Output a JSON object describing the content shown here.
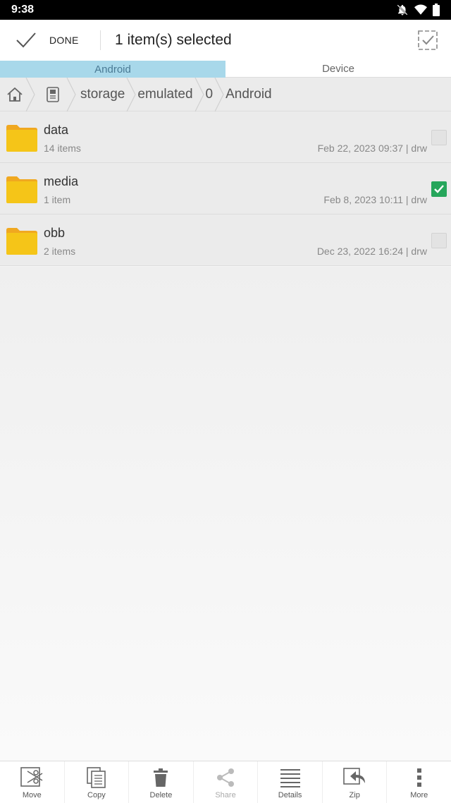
{
  "status_bar": {
    "time": "9:38"
  },
  "action_bar": {
    "done_label": "DONE",
    "title": "1 item(s) selected"
  },
  "tabs": [
    {
      "label": "Android",
      "active": true
    },
    {
      "label": "Device",
      "active": false
    }
  ],
  "breadcrumb": [
    "storage",
    "emulated",
    "0",
    "Android"
  ],
  "files": [
    {
      "name": "data",
      "count": "14 items",
      "meta": "Feb 22, 2023 09:37 | drw",
      "checked": false
    },
    {
      "name": "media",
      "count": "1 item",
      "meta": "Feb 8, 2023 10:11 | drw",
      "checked": true
    },
    {
      "name": "obb",
      "count": "2 items",
      "meta": "Dec 23, 2022 16:24 | drw",
      "checked": false
    }
  ],
  "toolbar": {
    "move": "Move",
    "copy": "Copy",
    "delete": "Delete",
    "share": "Share",
    "details": "Details",
    "zip": "Zip",
    "more": "More"
  },
  "colors": {
    "accent_tab": "#a8d8ea",
    "folder": "#f5c518",
    "check": "#26a65b"
  },
  "icons": [
    "home-icon",
    "device-icon",
    "folder-icon",
    "check-icon",
    "select-all-icon",
    "scissors-icon",
    "copy-icon",
    "trash-icon",
    "share-icon",
    "details-icon",
    "zip-icon",
    "more-icon"
  ]
}
